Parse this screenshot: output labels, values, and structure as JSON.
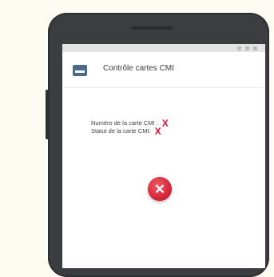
{
  "app": {
    "title": "Contrôle cartes CMI"
  },
  "info": {
    "card_number_label": "Numéro de la carte CMI :",
    "card_number_value": "X",
    "card_status_label": "Statut de la carte CMI:",
    "card_status_value": "X"
  },
  "icons": {
    "app_icon": "card-icon",
    "error_icon": "error-x-icon",
    "error_glyph": "✕"
  },
  "colors": {
    "error_red": "#e0113f",
    "app_icon": "#4a6a8f"
  }
}
